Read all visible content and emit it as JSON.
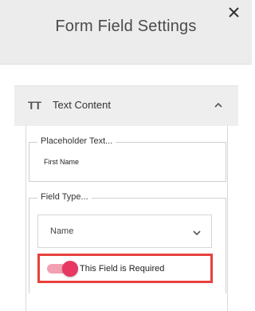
{
  "header": {
    "title": "Form Field Settings",
    "close_icon": "close-icon"
  },
  "section": {
    "icon": "text-format-icon",
    "icon_glyph": "TT",
    "label": "Text Content",
    "expanded": true
  },
  "placeholder_field": {
    "legend": "Placeholder Text...",
    "value": "First Name"
  },
  "field_type": {
    "legend": "Field Type...",
    "selected": "Name"
  },
  "required_toggle": {
    "label": "This Field is Required",
    "on": true
  },
  "colors": {
    "header_bg": "#ececec",
    "section_bg": "#eeeeee",
    "toggle_knob": "#e63862",
    "toggle_track": "#f3a0b3",
    "highlight_border": "#e8413c"
  }
}
